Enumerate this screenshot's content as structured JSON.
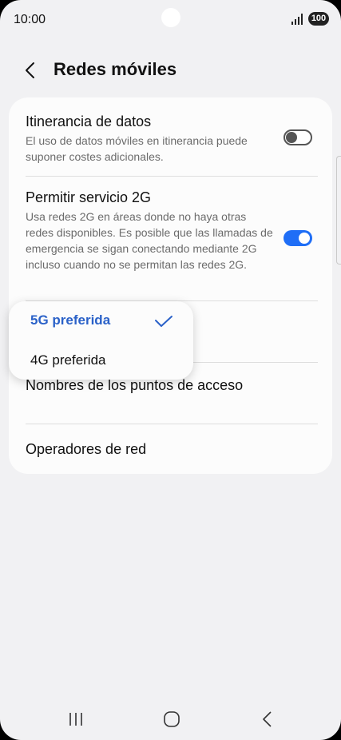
{
  "status": {
    "time": "10:00",
    "battery": "100"
  },
  "header": {
    "title": "Redes móviles"
  },
  "settings": {
    "roaming": {
      "title": "Itinerancia de datos",
      "desc": "El uso de datos móviles en itinerancia puede suponer costes adicionales.",
      "enabled": false
    },
    "service_2g": {
      "title": "Permitir servicio 2G",
      "desc": "Usa redes 2G en áreas donde no haya otras redes disponibles. Es posible que las llamadas de emergencia se sigan conectando mediante 2G incluso cuando no se permitan las redes 2G.",
      "enabled": true
    },
    "apn": {
      "title": "Nombres de los puntos de acceso"
    },
    "operators": {
      "title": "Operadores de red"
    }
  },
  "network_mode_menu": {
    "selected": "5G preferida",
    "options": [
      "5G preferida",
      "4G preferida"
    ]
  },
  "colors": {
    "accent": "#1f6ef6",
    "selected_text": "#2a61c8",
    "background": "#f1f1f3"
  },
  "navbar": {
    "icons": [
      "recent-apps-icon",
      "home-icon",
      "back-icon"
    ]
  }
}
